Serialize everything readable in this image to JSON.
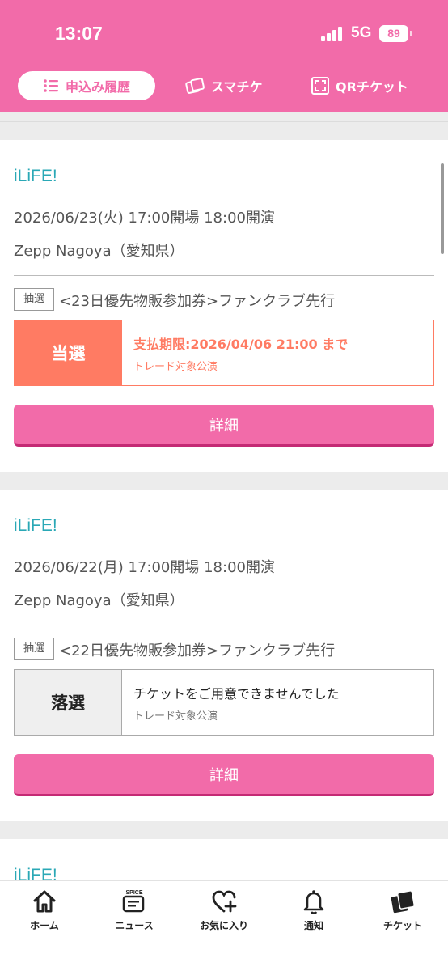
{
  "status": {
    "time": "13:07",
    "network": "5G",
    "battery": "89"
  },
  "tabs": [
    {
      "label": "申込み履歴",
      "active": true,
      "icon": "list-icon"
    },
    {
      "label": "スマチケ",
      "active": false,
      "icon": "smart-ticket-icon"
    },
    {
      "label": "QRチケット",
      "active": false,
      "icon": "qr-frame-icon"
    }
  ],
  "entries": [
    {
      "artist": "iLiFE!",
      "date": "2026/06/23(火) 17:00開場 18:00開演",
      "venue": "Zepp Nagoya（愛知県）",
      "badge": "抽選",
      "lottery": "<23日優先物販参加券>ファンクラブ先行",
      "result": "当選",
      "message": "支払期限:2026/04/06 21:00 まで",
      "sub": "トレード対象公演",
      "detail": "詳細"
    },
    {
      "artist": "iLiFE!",
      "date": "2026/06/22(月) 17:00開場 18:00開演",
      "venue": "Zepp Nagoya（愛知県）",
      "badge": "抽選",
      "lottery": "<22日優先物販参加券>ファンクラブ先行",
      "result": "落選",
      "message": "チケットをご用意できませんでした",
      "sub": "トレード対象公演",
      "detail": "詳細"
    },
    {
      "artist": "iLiFE!"
    }
  ],
  "nav": [
    {
      "label": "ホーム",
      "icon": "home-icon"
    },
    {
      "label": "ニュース",
      "icon": "spice-news-icon",
      "icon_text": "SPICE"
    },
    {
      "label": "お気に入り",
      "icon": "heart-plus-icon"
    },
    {
      "label": "通知",
      "icon": "bell-icon"
    },
    {
      "label": "チケット",
      "icon": "tickets-icon"
    }
  ],
  "colors": {
    "brand": "#f26ba9",
    "won": "#ff7b63",
    "artist": "#2aa8b6"
  }
}
